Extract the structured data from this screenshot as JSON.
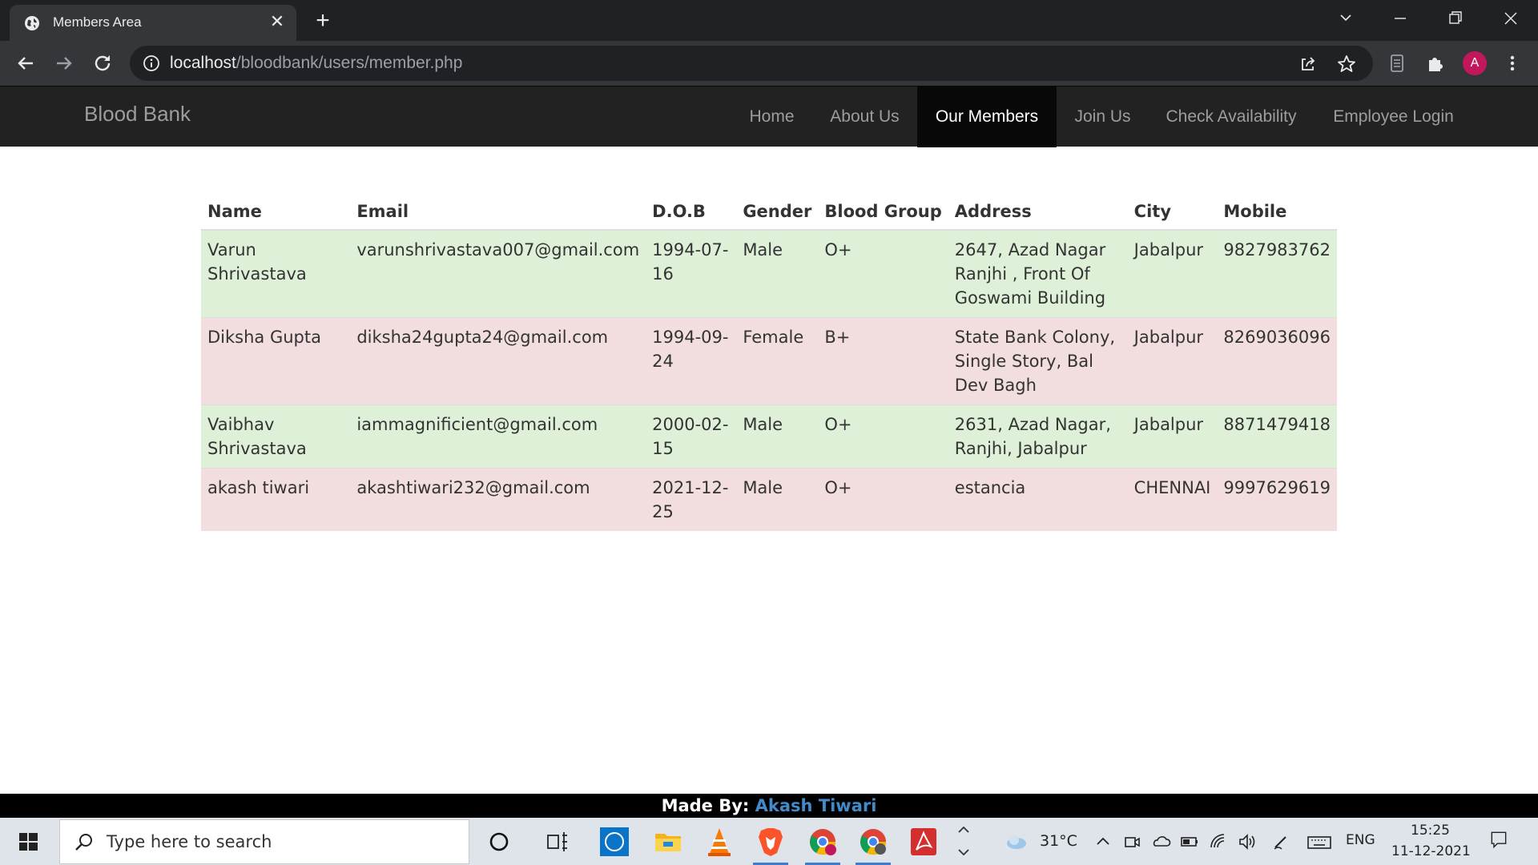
{
  "browser": {
    "tab_title": "Members Area",
    "url_host": "localhost",
    "url_path": "/bloodbank/users/member.php",
    "profile_initial": "A"
  },
  "navbar": {
    "brand": "Blood Bank",
    "items": [
      {
        "label": "Home",
        "active": false
      },
      {
        "label": "About Us",
        "active": false
      },
      {
        "label": "Our Members",
        "active": true
      },
      {
        "label": "Join Us",
        "active": false
      },
      {
        "label": "Check Availability",
        "active": false
      },
      {
        "label": "Employee Login",
        "active": false
      }
    ]
  },
  "table": {
    "headers": [
      "Name",
      "Email",
      "D.O.B",
      "Gender",
      "Blood Group",
      "Address",
      "City",
      "Mobile"
    ],
    "rows": [
      {
        "style": "success",
        "name": "Varun Shrivastava",
        "email": "varunshrivastava007@gmail.com",
        "dob": "1994-07-16",
        "gender": "Male",
        "blood_group": "O+",
        "address": "2647, Azad Nagar Ranjhi , Front Of Goswami Building",
        "city": "Jabalpur",
        "mobile": "9827983762"
      },
      {
        "style": "danger",
        "name": "Diksha Gupta",
        "email": "diksha24gupta24@gmail.com",
        "dob": "1994-09-24",
        "gender": "Female",
        "blood_group": "B+",
        "address": "State Bank Colony, Single Story, Bal Dev Bagh",
        "city": "Jabalpur",
        "mobile": "8269036096"
      },
      {
        "style": "success",
        "name": "Vaibhav Shrivastava",
        "email": "iammagnificient@gmail.com",
        "dob": "2000-02-15",
        "gender": "Male",
        "blood_group": "O+",
        "address": "2631, Azad Nagar, Ranjhi, Jabalpur",
        "city": "Jabalpur",
        "mobile": "8871479418"
      },
      {
        "style": "danger",
        "name": "akash tiwari",
        "email": "akashtiwari232@gmail.com",
        "dob": "2021-12-25",
        "gender": "Male",
        "blood_group": "O+",
        "address": "estancia",
        "city": "CHENNAI",
        "mobile": "9997629619"
      }
    ]
  },
  "footer": {
    "prefix": "Made By:",
    "author": "Akash Tiwari"
  },
  "taskbar": {
    "search_placeholder": "Type here to search",
    "weather": "31°C",
    "language": "ENG",
    "time": "15:25",
    "date": "11-12-2021"
  },
  "colors": {
    "navbar_bg": "#222222",
    "navbar_active": "#080808",
    "row_success": "#dff0d8",
    "row_danger": "#f2dede",
    "footer_link": "#428bca"
  }
}
